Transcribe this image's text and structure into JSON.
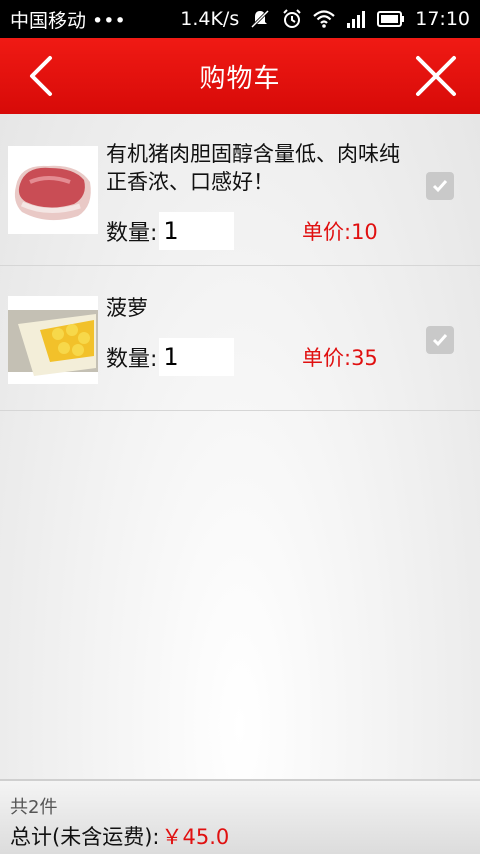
{
  "status_bar": {
    "carrier": "中国移动 •••",
    "speed": "1.4K/s",
    "time": "17:10"
  },
  "header": {
    "title": "购物车"
  },
  "cart": {
    "items": [
      {
        "name": "有机猪肉胆固醇含量低、肉味纯正香浓、口感好！",
        "qty_label": "数量:",
        "qty": "1",
        "price_label": "单价:10",
        "checked": true
      },
      {
        "name": "菠萝",
        "qty_label": "数量:",
        "qty": "1",
        "price_label": "单价:35",
        "checked": true
      }
    ]
  },
  "footer": {
    "count": "共2件",
    "total_label": "总计(未含运费):",
    "total_value": "￥45.0"
  },
  "colors": {
    "header_red": "#e5110e",
    "price_red": "#e01010"
  }
}
